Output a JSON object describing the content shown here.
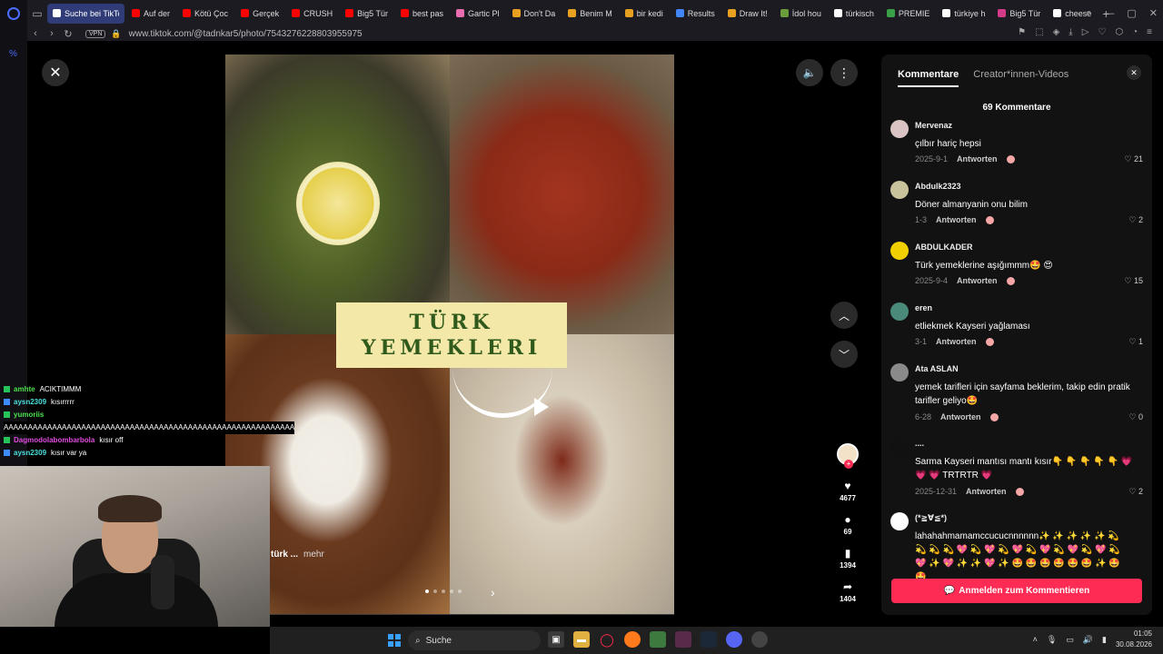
{
  "browser": {
    "tabs": [
      {
        "label": "Suche bei TikTo",
        "active": true,
        "color": "#ffffff"
      },
      {
        "label": "Auf der",
        "color": "#ff0000"
      },
      {
        "label": "Kötü Çoc",
        "color": "#ff0000"
      },
      {
        "label": "Gerçek",
        "color": "#ff0000"
      },
      {
        "label": "CRUSH",
        "color": "#ff0000"
      },
      {
        "label": "Big5 Tür",
        "color": "#ff0000"
      },
      {
        "label": "best pas",
        "color": "#ff0000"
      },
      {
        "label": "Gartic Pl",
        "color": "#e86cb0"
      },
      {
        "label": "Don't Da",
        "color": "#e8a020"
      },
      {
        "label": "Benim M",
        "color": "#e8a020"
      },
      {
        "label": "bir kedi",
        "color": "#e8a020"
      },
      {
        "label": "Results",
        "color": "#4285f4"
      },
      {
        "label": "Draw It!",
        "color": "#e8a020"
      },
      {
        "label": "İdol hou",
        "color": "#6a9e3c"
      },
      {
        "label": "türkisch",
        "color": "#ffffff"
      },
      {
        "label": "PREMIE",
        "color": "#3aa047"
      },
      {
        "label": "türkiye h",
        "color": "#ffffff"
      },
      {
        "label": "Big5 Tür",
        "color": "#d43a8a"
      },
      {
        "label": "cheese",
        "color": "#ffffff"
      }
    ],
    "vpn": "VPN",
    "url": "www.tiktok.com/@tadnkar5/photo/7543276228803955975",
    "zoom": "%"
  },
  "post": {
    "title_line1": "TÜRK",
    "title_line2": "YEMEKLERI",
    "caption": "türk ...",
    "more": "mehr",
    "likes": "4677",
    "comments": "69",
    "saves": "1394",
    "shares": "1404"
  },
  "panel": {
    "tab_comments": "Kommentare",
    "tab_creator": "Creator*innen-Videos",
    "count": "69 Kommentare",
    "reply_label": "Antworten",
    "login": "Anmelden zum Kommentieren",
    "comments": [
      {
        "user": "Mervenaz",
        "text": "çılbır hariç hepsi",
        "date": "2025-9-1",
        "likes": "21"
      },
      {
        "user": "Abdulk2323",
        "text": "Döner almanyanin onu bilim",
        "date": "1-3",
        "likes": "2"
      },
      {
        "user": "ABDULKADER",
        "text": "Türk yemeklerine aşığımmm🤩 😍",
        "date": "2025-9-4",
        "likes": "15"
      },
      {
        "user": "eren",
        "text": "etliekmek Kayseri yağlaması",
        "date": "3-1",
        "likes": "1"
      },
      {
        "user": "Ata ASLAN",
        "text": "yemek tarifleri için sayfama beklerim, takip edin pratik tarifler geliyo🤩",
        "date": "6-28",
        "likes": "0"
      },
      {
        "user": "....",
        "text": "Sarma Kayseri mantısı mantı kısır👇 👇 👇 👇 👇 💗 💗 💗 TRTRTR 💗",
        "date": "2025-12-31",
        "likes": "2"
      },
      {
        "user": "(*≧∀≦*)",
        "text": "lahahahmamamccucucnnnnnn✨ ✨ ✨ ✨ ✨ 💫 💫 💫 💫 💖 💫 💖 💫 💖 💫 💖 💫 💖 💫 💖 💫 💖 ✨ 💖 ✨ ✨ 💖 ✨ 🤩 🤩 🤩 🤩 🤩 🤩 ✨ 🤩 🤩",
        "date": "",
        "likes": ""
      }
    ]
  },
  "chat": [
    {
      "user": "amhte",
      "color": "#4be04b",
      "msg": "ACIKTIMMM"
    },
    {
      "user": "aysn2309",
      "color": "#4be0e0",
      "msg": "kısırrrrr"
    },
    {
      "user": "yumoriis",
      "color": "#4be04b",
      "msg": ""
    },
    {
      "user": "",
      "color": "#ffffff",
      "msg": "AAAAAAAAAAAAAAAAAAAAAAAAAAAAAAAAAAAAAAAAAAAAAAAAAAAAAAAAAAAA"
    },
    {
      "user": "Dagmodolabombarbola",
      "color": "#e04be0",
      "msg": "kısır off"
    },
    {
      "user": "aysn2309",
      "color": "#4be0e0",
      "msg": "kısır var ya"
    }
  ],
  "taskbar": {
    "search": "Suche",
    "time": "01:05",
    "date": "30.08.2026"
  }
}
